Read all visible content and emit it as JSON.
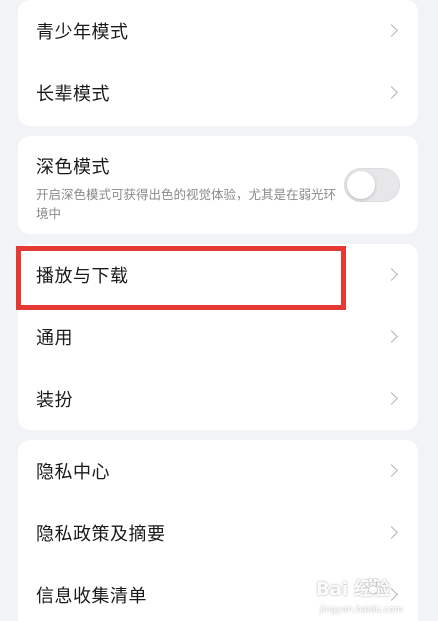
{
  "card1": {
    "items": [
      "青少年模式",
      "长辈模式"
    ]
  },
  "dark_mode": {
    "title": "深色模式",
    "description": "开启深色模式可获得出色的视觉体验，尤其是在弱光环境中",
    "enabled": false
  },
  "card3": {
    "items": [
      "播放与下载",
      "通用",
      "装扮"
    ]
  },
  "card4": {
    "items": [
      "隐私中心",
      "隐私政策及摘要",
      "信息收集清单"
    ]
  },
  "watermark": {
    "brand": "Bai  经验",
    "url": "jingyan.baidu.com"
  },
  "colors": {
    "highlight": "#e53935",
    "background": "#f2f3f7",
    "card": "#ffffff"
  }
}
